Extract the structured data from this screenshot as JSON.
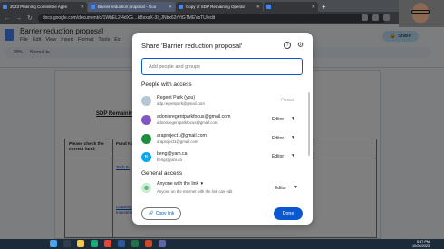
{
  "browser": {
    "tabs": [
      {
        "title": "2023 Planning Committee Agen",
        "color": "#4285f4",
        "active": false
      },
      {
        "title": "Barrier reduction proposal - Goo",
        "color": "#4285f4",
        "active": true
      },
      {
        "title": "Copy of SDP Remaining Operati",
        "color": "#4285f4",
        "active": false
      },
      {
        "title": "",
        "color": "#4285f4",
        "active": false
      }
    ],
    "new_tab": "+",
    "url": "docs.google.com/document/d/1WbEL2I4dXG…kBsxaX-3I_JNbx62rVtGTMEVsTU/edit"
  },
  "docs": {
    "title": "Barrier reduction proposal",
    "menu": [
      "File",
      "Edit",
      "View",
      "Insert",
      "Format",
      "Tools",
      "Ext"
    ],
    "toolbar_zoom": "90%",
    "toolbar_style": "Normal te",
    "share_label": "Share",
    "heading": "SDP Remaining",
    "table_left": "Please check the correct fund:",
    "table_right": "Fund Na",
    "link1": "Tech Bu",
    "link2": "Capacity Investment"
  },
  "dialog": {
    "title": "Share 'Barrier reduction proposal'",
    "input_placeholder": "Add people and groups",
    "people_heading": "People with access",
    "people": [
      {
        "name": "Regent Park (you)",
        "email": "adp.regentpark@gmail.com",
        "role": "Owner",
        "avatar_color": "#b5c7d3",
        "avatar_letter": ""
      },
      {
        "name": "adonisregentparkfocus@gmail.com",
        "email": "adonisregentparkfocus@gmail.com",
        "role": "Editor",
        "avatar_color": "#7e57c2",
        "avatar_letter": ""
      },
      {
        "name": "araproject1@gmail.com",
        "email": "araproject1@gmail.com",
        "role": "Editor",
        "avatar_color": "#1e8e3e",
        "avatar_letter": ""
      },
      {
        "name": "beng@yam.ca",
        "email": "beng@yam.ca",
        "role": "Editor",
        "avatar_color": "#03a9f4",
        "avatar_letter": "B"
      }
    ],
    "general_heading": "General access",
    "general_access": {
      "title": "Anyone with the link",
      "description": "Anyone on the Internet with the link can edit",
      "role": "Editor"
    },
    "copy_link_label": "Copy link",
    "done_label": "Done"
  },
  "taskbar": {
    "time": "5:37 PM",
    "date": "10/26/2023"
  }
}
